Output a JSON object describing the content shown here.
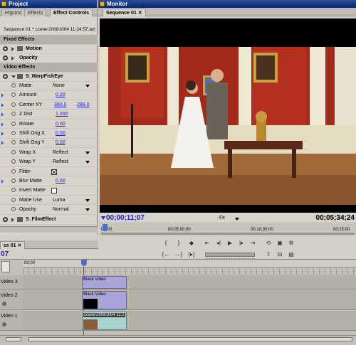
{
  "project_panel": {
    "title": "Project",
    "tabs": [
      "H'gsmo",
      "Effects",
      "Effect Controls"
    ],
    "active_tab": "Effect Controls",
    "sequence_line": "Sequence 01 * ccene'20081004 11:24:57.avi",
    "fixed_effects_header": "Fixed Effects",
    "video_effects_header": "Video Effects",
    "motion_label": "Motion",
    "opacity_label": "Opacity",
    "effect_name": "S_WarpFishEye",
    "params": [
      {
        "label": "Matte",
        "value": "None",
        "type": "dropdown"
      },
      {
        "label": "Amount",
        "value": "0.20",
        "type": "number"
      },
      {
        "label": "Center XY",
        "value": "360.0",
        "value2": "288.0",
        "type": "xy"
      },
      {
        "label": "Z Dist",
        "value": "1.000",
        "type": "number"
      },
      {
        "label": "Rotate",
        "value": "0.00",
        "type": "number"
      },
      {
        "label": "Shift Orig X",
        "value": "0.00",
        "type": "number"
      },
      {
        "label": "Shift Orig Y",
        "value": "0.00",
        "type": "number"
      },
      {
        "label": "Wrap X",
        "value": "Reflect",
        "type": "dropdown"
      },
      {
        "label": "Wrap Y",
        "value": "Reflect",
        "type": "dropdown"
      },
      {
        "label": "Filter",
        "value": "",
        "type": "checkbox-checked"
      },
      {
        "label": "Blur Matte",
        "value": "0.00",
        "type": "number"
      },
      {
        "label": "Invert Matte",
        "value": "",
        "type": "checkbox"
      },
      {
        "label": "Matte Use",
        "value": "Luma",
        "type": "dropdown"
      },
      {
        "label": "Opacity",
        "value": "Normal",
        "type": "dropdown"
      }
    ],
    "second_effect": "S_FilmEffect"
  },
  "monitor": {
    "title": "Monitor",
    "tab": "Sequence 01",
    "timecode_current": "00;00;11;07",
    "fit_label": "Fit",
    "timecode_duration": "00;05;34;24",
    "ruler_labels": [
      "00;00",
      "00;05;00;00",
      "00;10;00;00",
      "00;15;00"
    ]
  },
  "timeline": {
    "tab": "ce 01",
    "timecode": "07",
    "ruler_label": "00;00",
    "tracks": [
      {
        "label": "Video 3",
        "clip": "Black Video"
      },
      {
        "label": "Video 2",
        "clip": "Black Video"
      },
      {
        "label": "Video 1",
        "clip": "ccene'20081004 11:2"
      }
    ]
  },
  "colors": {
    "titlebar": "#0a2466",
    "panel_bg": "#d4d0c8",
    "timecode_blue": "#1f1fbf",
    "clip_purple": "#a8a4d8",
    "clip_teal": "#a8d4d0"
  }
}
